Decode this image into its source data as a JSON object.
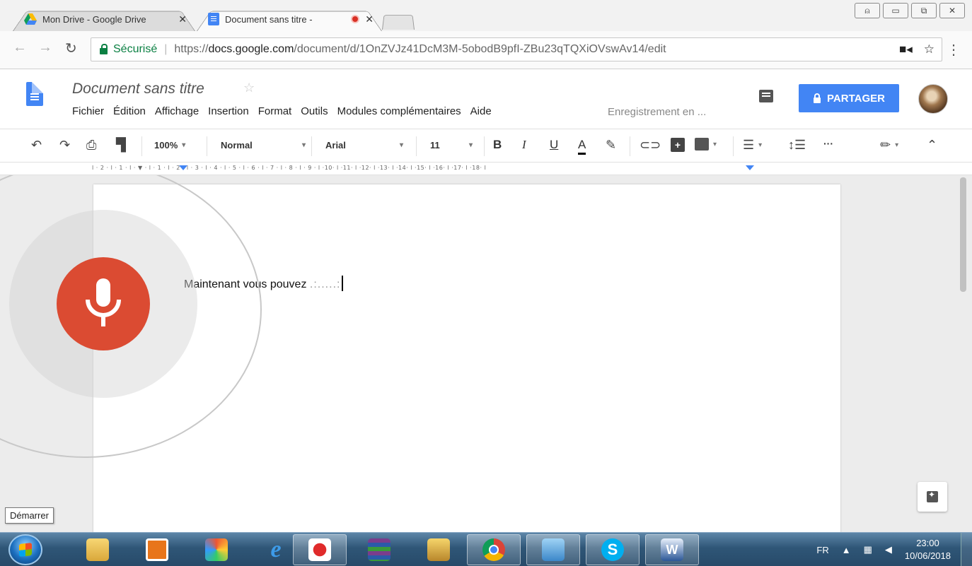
{
  "browser": {
    "tabs": [
      {
        "title": "Mon Drive - Google Drive",
        "active": false
      },
      {
        "title": "Document sans titre - ",
        "active": true,
        "recording": true
      }
    ],
    "address": {
      "secure_label": "Sécurisé",
      "url_scheme": "https://",
      "url_host": "docs.google.com",
      "url_path": "/document/d/1OnZVJz41DcM3M-5obodB9pfI-ZBu23qTQXiOVswAv14/edit"
    },
    "window_controls": [
      "user",
      "minimize",
      "restore",
      "close"
    ]
  },
  "docs": {
    "title": "Document sans titre",
    "menus": [
      "Fichier",
      "Édition",
      "Affichage",
      "Insertion",
      "Format",
      "Outils",
      "Modules complémentaires",
      "Aide"
    ],
    "save_status": "Enregistrement en ...",
    "share_label": "PARTAGER",
    "accent_color": "#4285f4",
    "toolbar": {
      "zoom": "100%",
      "style": "Normal",
      "font": "Arial",
      "size": "11",
      "bold": "B",
      "italic": "I",
      "underline": "U",
      "text_color": "A",
      "more": "···"
    },
    "ruler_labels": "l · 2 · l · 1 · l · ▼ · l · 1 · l · 2 · l · 3 · l · 4 · l · 5 · l · 6 · l · 7 · l · 8 · l · 9 · l ·10· l ·11· l ·12· l ·13· l ·14· l ·15· l ·16· l ·17· l ·18· l",
    "body_text": "Maintenant vous pouvez ",
    "pending_text": ".:.....:",
    "voice_typing": {
      "active": true,
      "mic_color": "#db4b32"
    }
  },
  "tooltip": "Démarrer",
  "taskbar": {
    "items": [
      "file-explorer",
      "media-player",
      "paint",
      "internet-explorer",
      "solitaire",
      "winrar",
      "freecell",
      "chrome",
      "control-panel",
      "skype",
      "word"
    ],
    "language": "FR",
    "time": "23:00",
    "date": "10/06/2018"
  }
}
